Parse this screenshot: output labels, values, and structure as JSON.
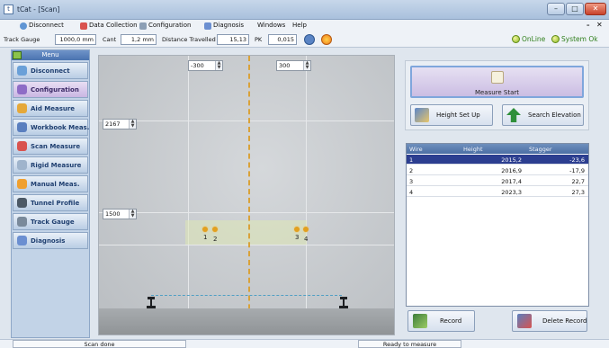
{
  "window": {
    "title": "tCat - [Scan]",
    "minimize": "–",
    "maximize": "□",
    "close": "✕"
  },
  "menubar": {
    "items": [
      "Disconnect",
      "Data Collection",
      "Configuration",
      "Diagnosis",
      "Windows",
      "Help"
    ],
    "mdi_minimize": "– ",
    "mdi_close": "✕"
  },
  "toolbar": {
    "track_gauge_label": "Track Gauge",
    "track_gauge_value": "1000,0 mm",
    "cant_label": "Cant",
    "cant_value": "1,2 mm",
    "distance_label": "Distance Travelled",
    "distance_value": "15,13",
    "pk_label": "PK",
    "pk_value": "0,015",
    "online_label": "OnLine",
    "system_label": "System Ok"
  },
  "nav": {
    "header": "Menu",
    "items": [
      {
        "label": "Disconnect",
        "color": "#6aa0d8"
      },
      {
        "label": "Configuration",
        "color": "#8e6cc6"
      },
      {
        "label": "Aid Measure",
        "color": "#e5a83a"
      },
      {
        "label": "Workbook Meas.",
        "color": "#5a7fbf"
      },
      {
        "label": "Scan Measure",
        "color": "#d9534f"
      },
      {
        "label": "Rigid Measure",
        "color": "#9fb4cc"
      },
      {
        "label": "Manual Meas.",
        "color": "#f0a030"
      },
      {
        "label": "Tunnel Profile",
        "color": "#4c5966"
      },
      {
        "label": "Track Gauge",
        "color": "#7a8a9b"
      },
      {
        "label": "Diagnosis",
        "color": "#6b8fd1"
      }
    ],
    "active_index": 1
  },
  "scan": {
    "stagger_left": "-300",
    "stagger_right": "300",
    "height_upper": "2167",
    "height_lower": "1500",
    "wires": [
      "1",
      "2",
      "3",
      "4"
    ]
  },
  "actions": {
    "measure_start": "Measure Start",
    "height_setup": "Height Set Up",
    "search_elevation": "Search Elevation",
    "record": "Record",
    "delete_record": "Delete Record"
  },
  "table": {
    "columns": [
      "Wire",
      "Height",
      "Stagger"
    ],
    "rows": [
      [
        "1",
        "2015,2",
        "-23,6"
      ],
      [
        "2",
        "2016,9",
        "-17,9"
      ],
      [
        "3",
        "2017,4",
        "22,7"
      ],
      [
        "4",
        "2023,3",
        "27,3"
      ]
    ],
    "selected_row": 0
  },
  "statusbar": {
    "left": "Scan done",
    "right": "Ready to measure"
  },
  "colors": {
    "accent": "#4a73b0",
    "selection": "#2c3e90",
    "status_ok": "#2f7f1b",
    "wire_marker": "#e2a020"
  }
}
